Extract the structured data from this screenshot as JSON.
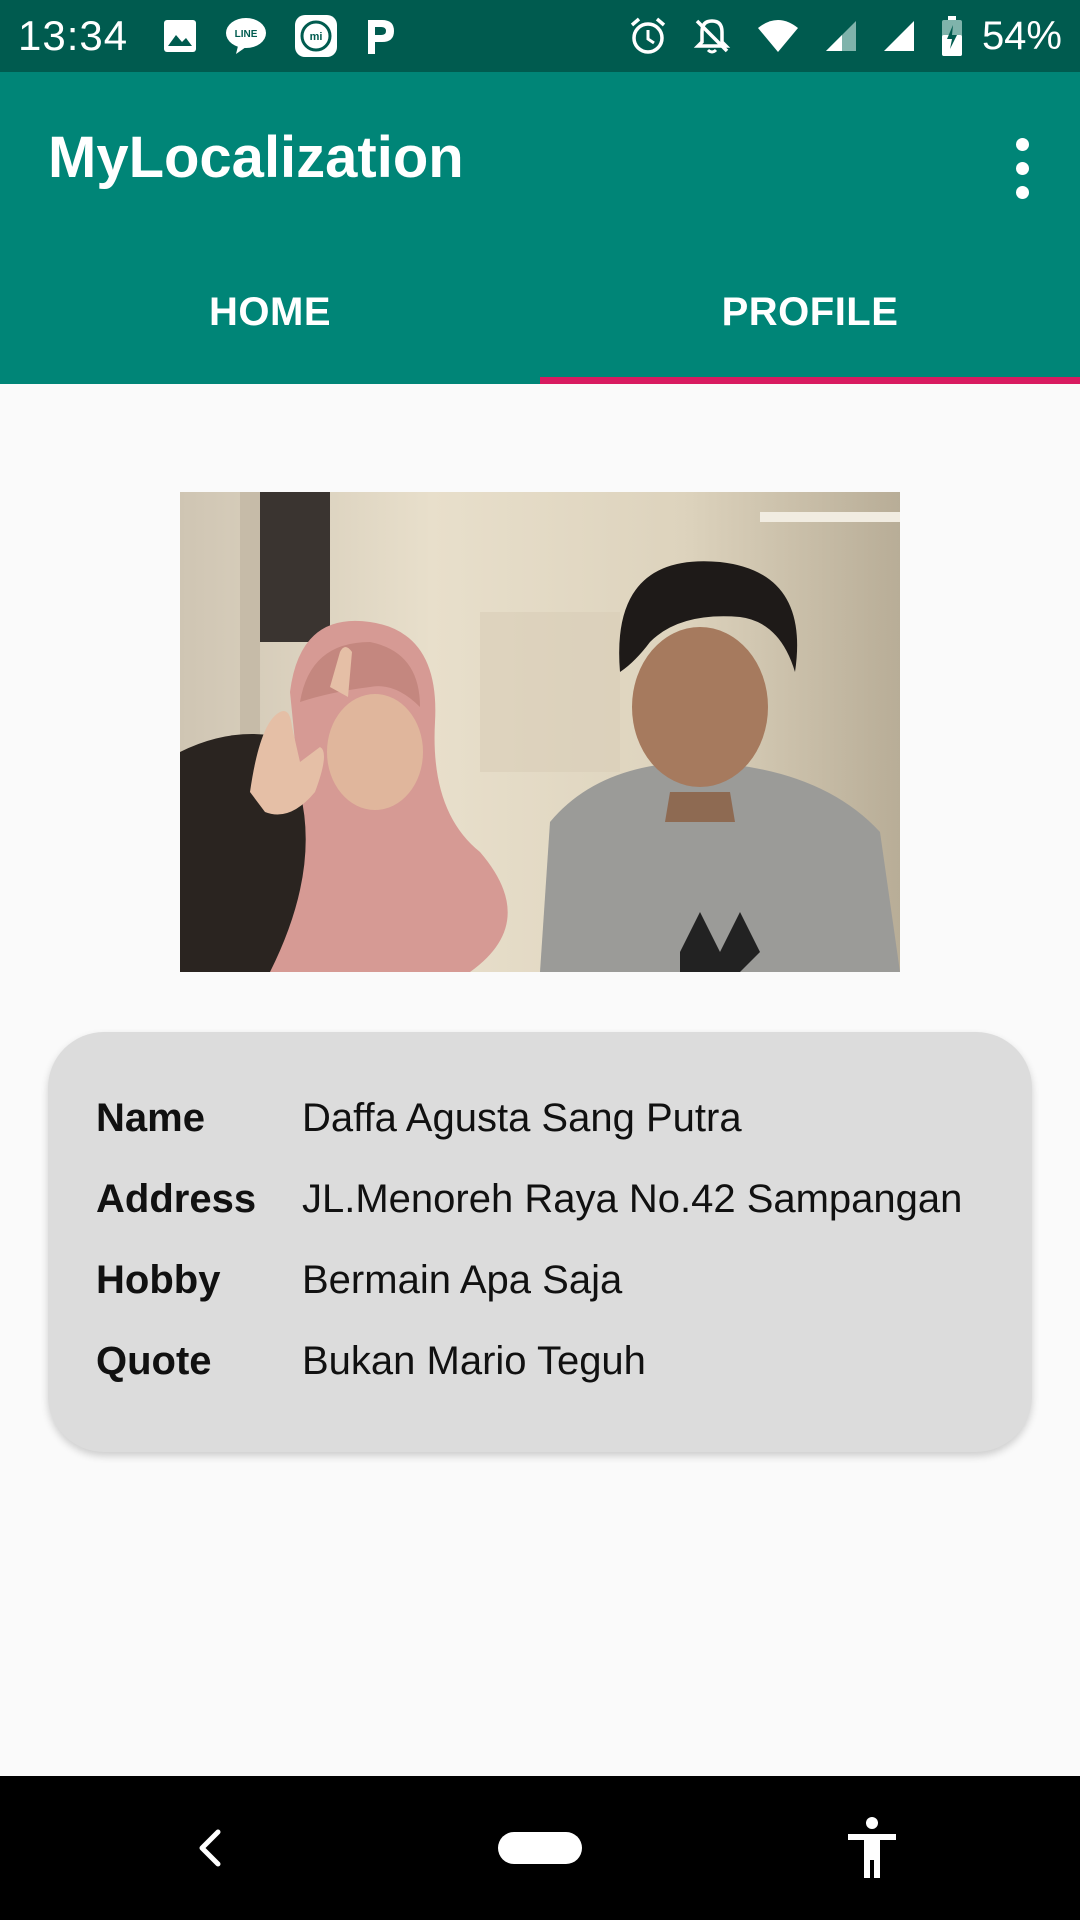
{
  "status_bar": {
    "time": "13:34",
    "battery": "54%",
    "left_icons": [
      "image-icon",
      "line-icon",
      "mi-icon",
      "p-icon"
    ],
    "right_icons": [
      "alarm-icon",
      "notifications-off-icon",
      "wifi-icon",
      "signal-icon",
      "signal-icon",
      "battery-icon"
    ]
  },
  "app_bar": {
    "title": "MyLocalization",
    "menu_icon": "more-vert-icon"
  },
  "tabs": [
    {
      "label": "HOME",
      "active": false
    },
    {
      "label": "PROFILE",
      "active": true
    }
  ],
  "profile": {
    "fields": [
      {
        "label": "Name",
        "value": "Daffa Agusta Sang Putra"
      },
      {
        "label": "Address",
        "value": "JL.Menoreh Raya No.42 Sampangan"
      },
      {
        "label": "Hobby",
        "value": "Bermain Apa Saja"
      },
      {
        "label": "Quote",
        "value": "Bukan Mario Teguh"
      }
    ]
  },
  "nav_bar": {
    "icons": [
      "back-icon",
      "home-pill-icon",
      "accessibility-icon"
    ]
  },
  "colors": {
    "status_bar": "#005b4f",
    "app_bar": "#008577",
    "tab_indicator": "#d81b60",
    "card": "#dcdcdc",
    "background": "#fafafa"
  }
}
